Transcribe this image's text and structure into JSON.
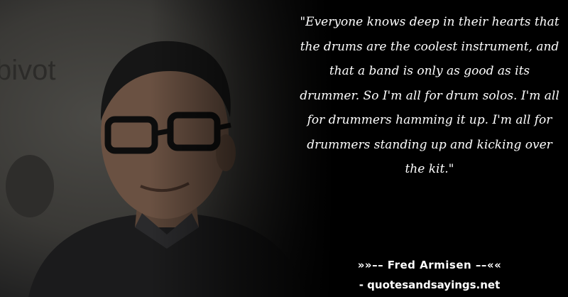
{
  "quote": {
    "text": "\"Everyone knows deep in their hearts that the drums are the coolest instrument, and that a band is only as good as its drummer. So I'm all for drum solos. I'm all for drummers hamming it up. I'm all for drummers standing up and kicking over the kit.\"",
    "author_line": "»»–– Fred Armisen ––««",
    "source": "- quotesandsayings.net"
  },
  "photo": {
    "backdrop_text": "bivot"
  },
  "colors": {
    "background": "#000000",
    "text": "#ffffff"
  }
}
